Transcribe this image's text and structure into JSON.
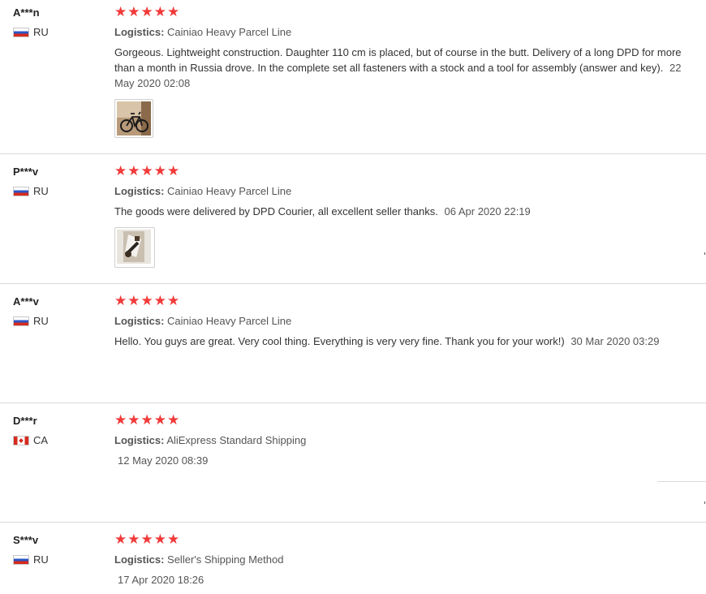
{
  "reviews": [
    {
      "user": "A***n",
      "country": "RU",
      "rating": 5,
      "logistics_label": "Logistics:",
      "logistics": "Cainiao Heavy Parcel Line",
      "text": "Gorgeous. Lightweight construction. Daughter 110 cm is placed, but of course in the butt. Delivery of a long DPD for more than a month in Russia drove. In the complete set all fasteners with a stock and a tool for assembly (answer and key).",
      "date": "22 May 2020 02:08",
      "photo": "bicycle-photo"
    },
    {
      "user": "P***v",
      "country": "RU",
      "rating": 5,
      "logistics_label": "Logistics:",
      "logistics": "Cainiao Heavy Parcel Line",
      "text": "The goods were delivered by DPD Courier, all excellent seller thanks.",
      "date": "06 Apr 2020 22:19",
      "photo": "parts-photo"
    },
    {
      "user": "A***v",
      "country": "RU",
      "rating": 5,
      "logistics_label": "Logistics:",
      "logistics": "Cainiao Heavy Parcel Line",
      "text": "Hello. You guys are great. Very cool thing. Everything is very very fine. Thank you for your work!)",
      "date": "30 Mar 2020 03:29"
    },
    {
      "user": "D***r",
      "country": "CA",
      "rating": 5,
      "logistics_label": "Logistics:",
      "logistics": "AliExpress Standard Shipping",
      "date": "12 May 2020 08:39"
    },
    {
      "user": "S***v",
      "country": "RU",
      "rating": 5,
      "logistics_label": "Logistics:",
      "logistics": "Seller's Shipping Method",
      "date": "17 Apr 2020 18:26"
    }
  ],
  "colors": {
    "star": "#f13a3a",
    "divider": "#d9d9d9",
    "text": "#333333"
  }
}
